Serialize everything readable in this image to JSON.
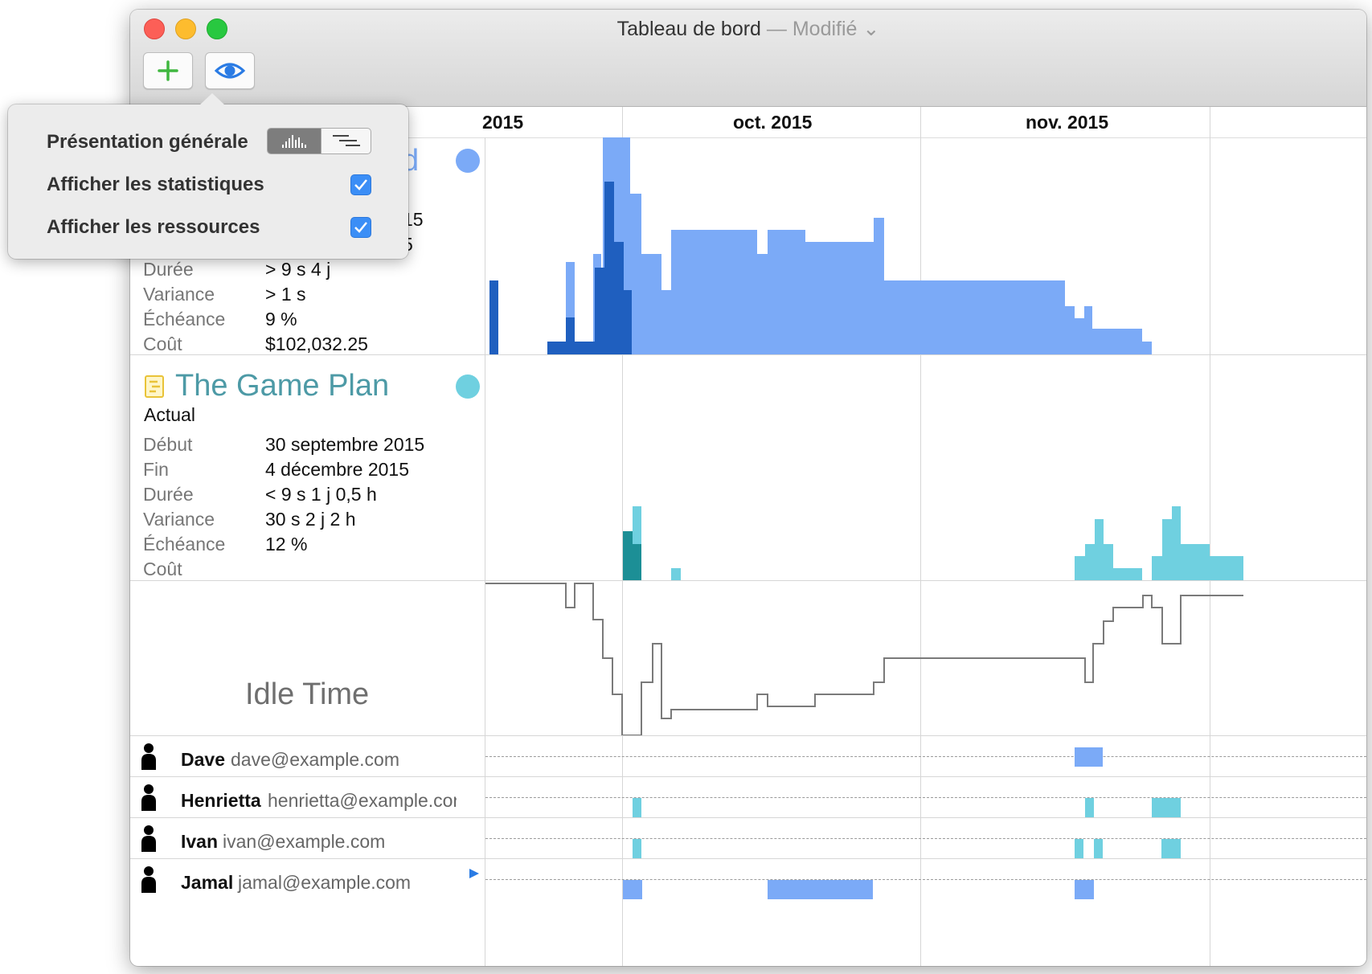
{
  "window": {
    "title": "Tableau de bord",
    "status": "— Modifié"
  },
  "toolbar": {
    "add_icon": "plus-icon",
    "view_icon": "eye-icon"
  },
  "timeline": {
    "months": [
      "2015",
      "oct. 2015",
      "nov. 2015"
    ]
  },
  "popover": {
    "overview_label": "Présentation générale",
    "overview_options": [
      "histogram-icon",
      "gantt-bars-icon"
    ],
    "stats_label": "Afficher les statistiques",
    "stats_checked": true,
    "resources_label": "Afficher les ressources",
    "resources_checked": true
  },
  "project1": {
    "title_fragment": "d",
    "dot_color": "#7baaf7",
    "partial_values": [
      "15",
      "5"
    ],
    "rows": [
      {
        "label": "Durée",
        "value": "> 9 s 4 j"
      },
      {
        "label": "Variance",
        "value": "> 1 s"
      },
      {
        "label": "Échéance",
        "value": "9 %"
      },
      {
        "label": "Coût",
        "value": "$102,032.25"
      }
    ]
  },
  "project2": {
    "title": "The Game Plan",
    "subtitle": "Actual",
    "dot_color": "#6fd0e0",
    "rows": [
      {
        "label": "Début",
        "value": "30 septembre 2015"
      },
      {
        "label": "Fin",
        "value": "4 décembre 2015"
      },
      {
        "label": "Durée",
        "value": "< 9 s 1 j 0,5 h"
      },
      {
        "label": "Variance",
        "value": "30 s 2 j 2 h"
      },
      {
        "label": "Échéance",
        "value": "12 %"
      },
      {
        "label": "Coût",
        "value": ""
      }
    ]
  },
  "idle": {
    "label": "Idle Time"
  },
  "resources": [
    {
      "name": "Dave",
      "email": "dave@example.com"
    },
    {
      "name": "Henrietta",
      "email": "henrietta@example.cor"
    },
    {
      "name": "Ivan",
      "email": "ivan@example.com"
    },
    {
      "name": "Jamal",
      "email": "jamal@example.com"
    }
  ],
  "colors": {
    "blue_light": "#7baaf7",
    "blue_dark": "#1f5fbf",
    "teal_light": "#6fd0e0",
    "teal_dark": "#1c8f96",
    "checkbox": "#3b8ef6"
  }
}
